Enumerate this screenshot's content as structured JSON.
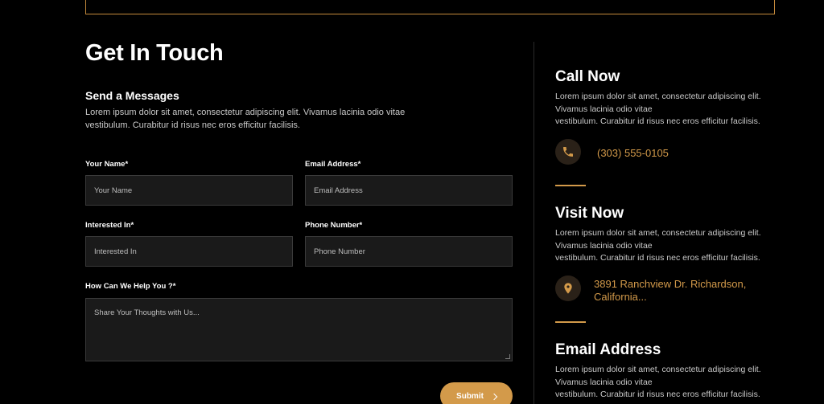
{
  "form": {
    "title": "Get In Touch",
    "subtitle": "Send a Messages",
    "intro_line1": "Lorem ipsum dolor sit amet, consectetur adipiscing elit. Vivamus lacinia odio vitae",
    "intro_line2": "vestibulum. Curabitur id risus nec eros efficitur facilisis.",
    "fields": {
      "name": {
        "label": "Your Name*",
        "placeholder": "Your Name"
      },
      "email": {
        "label": "Email Address*",
        "placeholder": "Email Address"
      },
      "interest": {
        "label": "Interested In*",
        "placeholder": "Interested In"
      },
      "phone": {
        "label": "Phone Number*",
        "placeholder": "Phone Number"
      },
      "message": {
        "label": "How Can We Help You ?*",
        "placeholder": "Share Your Thoughts with Us..."
      }
    },
    "submit_label": "Submit"
  },
  "contact": {
    "call": {
      "title": "Call Now",
      "text_line1": "Lorem ipsum dolor sit amet, consectetur adipiscing elit.",
      "text_line2": "Vivamus lacinia odio vitae",
      "text_line3": "vestibulum. Curabitur id risus nec eros efficitur facilisis.",
      "value": "(303) 555-0105",
      "icon": "phone-icon"
    },
    "visit": {
      "title": "Visit Now",
      "text_line1": "Lorem ipsum dolor sit amet, consectetur adipiscing elit.",
      "text_line2": "Vivamus lacinia odio vitae",
      "text_line3": "vestibulum. Curabitur id risus nec eros efficitur facilisis.",
      "value_line1": "3891 Ranchview Dr. Richardson,",
      "value_line2": "California...",
      "icon": "location-pin-icon"
    },
    "email": {
      "title": "Email Address",
      "text_line1": "Lorem ipsum dolor sit amet, consectetur adipiscing elit.",
      "text_line2": "Vivamus lacinia odio vitae",
      "text_line3": "vestibulum. Curabitur id risus nec eros efficitur facilisis."
    }
  },
  "colors": {
    "accent": "#d39a4a",
    "background": "#000000",
    "field_bg": "#1a1a1a",
    "icon_bg": "#2a2118"
  }
}
